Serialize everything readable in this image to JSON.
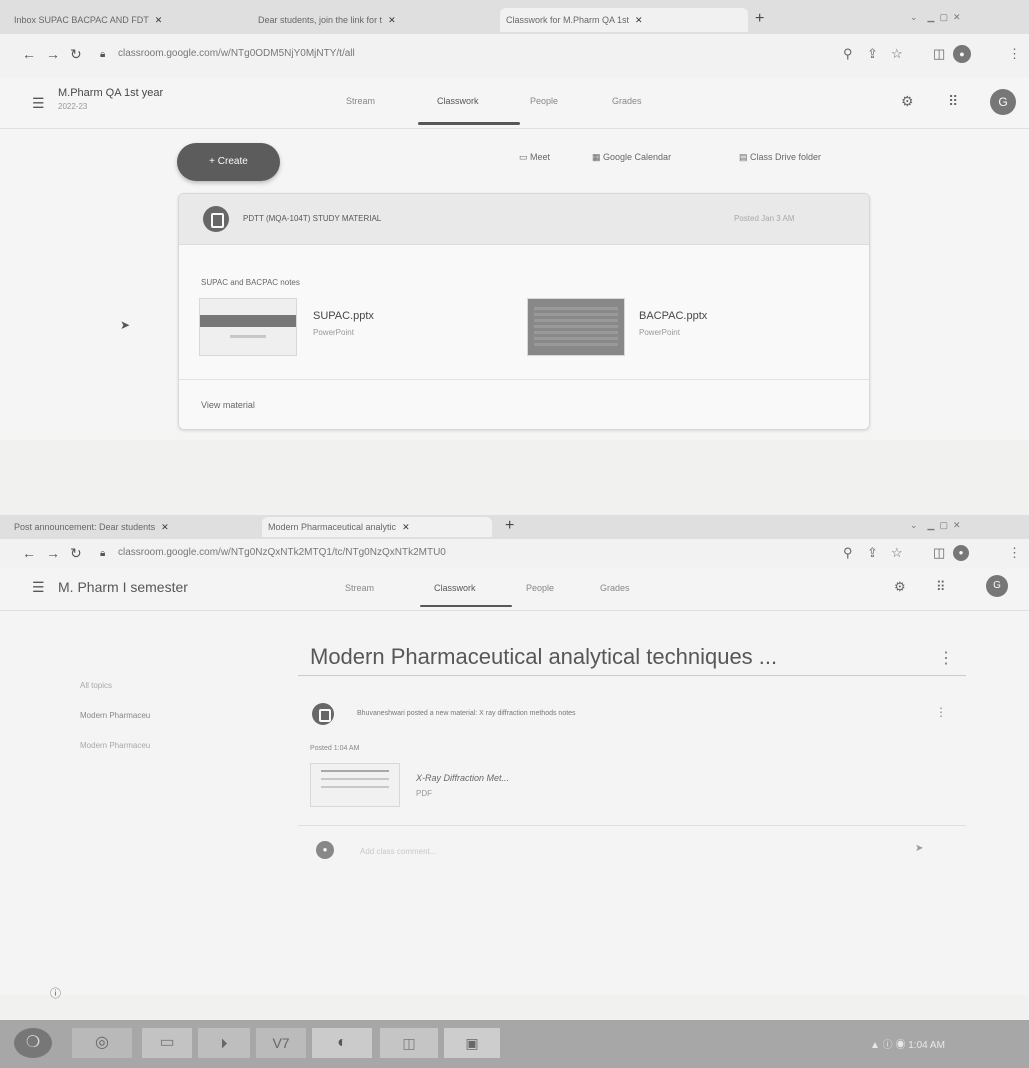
{
  "screen1": {
    "tabs": [
      {
        "label": "Inbox SUPAC BACPAC AND FDT"
      },
      {
        "label": "Dear students, join the link for t"
      },
      {
        "label": "Classwork for M.Pharm QA 1st"
      }
    ],
    "tab_close": "✕",
    "new_tab": "+",
    "url": "classroom.google.com/w/NTg0ODM5NjY0MjNTY/t/all",
    "class": {
      "title": "M.Pharm QA 1st year",
      "subtitle": "2022-23"
    },
    "nav": [
      "Stream",
      "Classwork",
      "People",
      "Grades"
    ],
    "active_nav": "Classwork",
    "avatar": "G",
    "create_label": "+  Create",
    "links": [
      "Meet",
      "Google Calendar",
      "Class Drive folder"
    ],
    "material": {
      "title": "PDTT (MQA-104T) STUDY MATERIAL",
      "posted": "Posted Jan 3 AM",
      "description": "SUPAC and BACPAC notes",
      "attachments": [
        {
          "name": "SUPAC.pptx",
          "type": "PowerPoint"
        },
        {
          "name": "BACPAC.pptx",
          "type": "PowerPoint"
        }
      ],
      "view": "View material"
    }
  },
  "screen2": {
    "tabs": [
      {
        "label": "Post announcement: Dear students"
      },
      {
        "label": "Modern Pharmaceutical analytic"
      }
    ],
    "tab_close": "✕",
    "new_tab": "+",
    "url": "classroom.google.com/w/NTg0NzQxNTk2MTQ1/tc/NTg0NzQxNTk2MTU0",
    "class": {
      "title": "M. Pharm I semester"
    },
    "nav": [
      "Stream",
      "Classwork",
      "People",
      "Grades"
    ],
    "active_nav": "Classwork",
    "avatar": "G",
    "side": [
      "All topics",
      "Modern Pharmaceu",
      "Modern Pharmaceu"
    ],
    "topic_title": "Modern Pharmaceutical analytical techniques ...",
    "post": {
      "text": "Bhuvaneshwari posted a new material: X ray diffraction methods notes",
      "label": "Posted 1:04 AM",
      "attachment": {
        "name": "X-Ray Diffraction Met...",
        "type": "PDF"
      },
      "comment_placeholder": "Add class comment..."
    }
  },
  "taskbar": {
    "items": [
      "❍",
      "◎",
      "▭",
      "⏵",
      "V7",
      "◐",
      "◫",
      "▣"
    ],
    "tray": "▲ ⓘ ◉  1:04 AM"
  },
  "icons": [
    "menu-icon",
    "lock-icon",
    "back-icon",
    "forward-icon",
    "refresh-icon",
    "apps-icon",
    "settings-icon",
    "video-icon",
    "calendar-icon",
    "drive-icon",
    "more-icon",
    "help-icon"
  ]
}
